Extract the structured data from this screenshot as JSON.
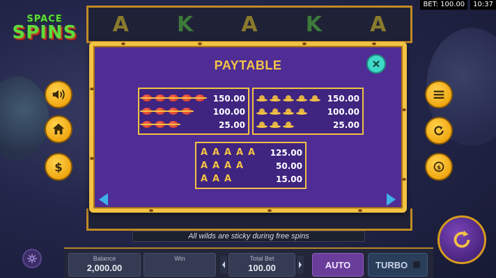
{
  "status": {
    "bet": "BET: 100.00",
    "time": "10:37"
  },
  "logo": {
    "line1": "SPACE",
    "line2": "SPINS"
  },
  "reels_top_symbols": [
    "A",
    "K",
    "A",
    "K",
    "A"
  ],
  "paytable": {
    "title": "PAYTABLE",
    "box1": {
      "symbol": "planet-icon",
      "rows": [
        {
          "count": 5,
          "value": "150.00"
        },
        {
          "count": 4,
          "value": "100.00"
        },
        {
          "count": 3,
          "value": "25.00"
        }
      ]
    },
    "box2": {
      "symbol": "ufo-icon",
      "rows": [
        {
          "count": 5,
          "value": "150.00"
        },
        {
          "count": 4,
          "value": "100.00"
        },
        {
          "count": 3,
          "value": "25.00"
        }
      ]
    },
    "box3": {
      "symbol": "A",
      "rows": [
        {
          "count": 5,
          "value": "125.00"
        },
        {
          "count": 4,
          "value": "50.00"
        },
        {
          "count": 3,
          "value": "15.00"
        }
      ]
    }
  },
  "banner": "All wilds are sticky during free spins",
  "bottom": {
    "balance_label": "Balance",
    "balance_value": "2,000.00",
    "win_label": "Win",
    "win_value": "",
    "totalbet_label": "Total Bet",
    "totalbet_value": "100.00",
    "auto_label": "AUTO",
    "turbo_label": "TURBO"
  },
  "colors": {
    "accent": "#f3c243",
    "modal_bg": "#4f2d95",
    "close": "#3fd9c8",
    "arrow": "#3fb0e6"
  }
}
